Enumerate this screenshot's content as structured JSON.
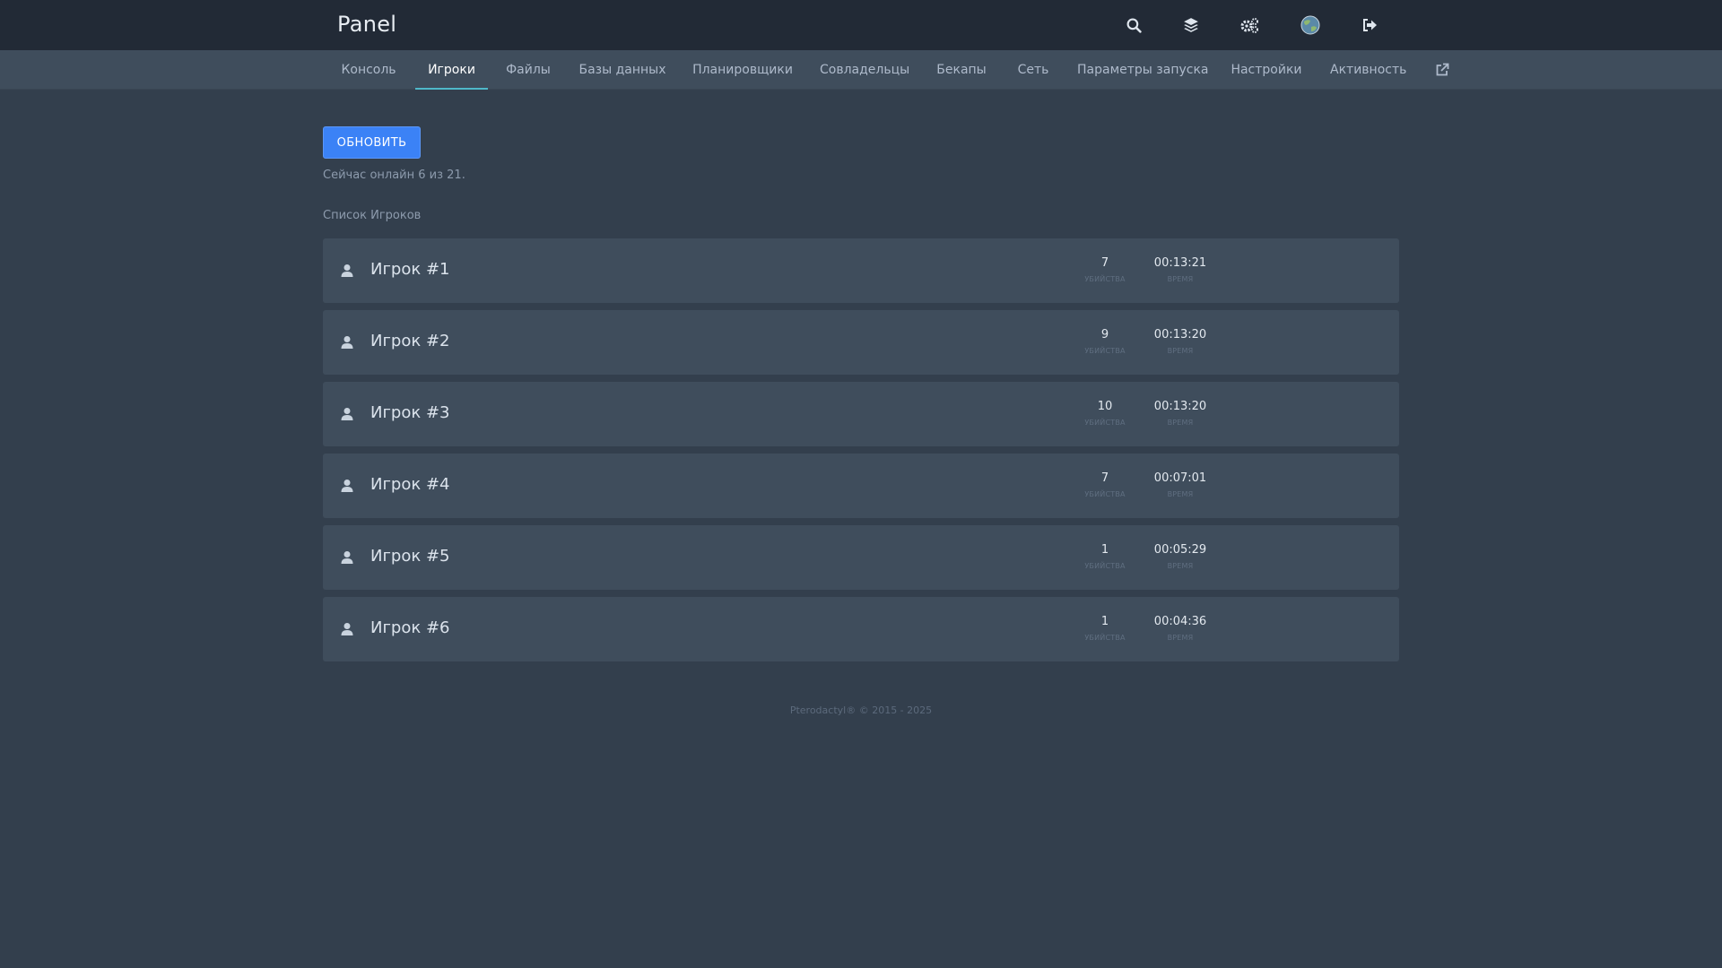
{
  "brand": "Panel",
  "topbar_icons": [
    "search-icon",
    "layers-icon",
    "gears-icon",
    "globe-icon",
    "logout-icon"
  ],
  "tabs": [
    {
      "label": "Консоль"
    },
    {
      "label": "Игроки",
      "active": true
    },
    {
      "label": "Файлы"
    },
    {
      "label": "Базы данных"
    },
    {
      "label": "Планировщики"
    },
    {
      "label": "Совладельцы"
    },
    {
      "label": "Бекапы"
    },
    {
      "label": "Сеть"
    },
    {
      "label": "Параметры запуска"
    },
    {
      "label": "Настройки"
    },
    {
      "label": "Активность"
    }
  ],
  "refresh_label": "ОБНОВИТЬ",
  "online_text": "Сейчас онлайн 6 из 21.",
  "list_title": "Список Игроков",
  "stat_labels": {
    "kills": "УБИЙСТВА",
    "time": "ВРЕМЯ"
  },
  "players": [
    {
      "name": "Игрок #1",
      "kills": "7",
      "time": "00:13:21"
    },
    {
      "name": "Игрок #2",
      "kills": "9",
      "time": "00:13:20"
    },
    {
      "name": "Игрок #3",
      "kills": "10",
      "time": "00:13:20"
    },
    {
      "name": "Игрок #4",
      "kills": "7",
      "time": "00:07:01"
    },
    {
      "name": "Игрок #5",
      "kills": "1",
      "time": "00:05:29"
    },
    {
      "name": "Игрок #6",
      "kills": "1",
      "time": "00:04:36"
    }
  ],
  "footer": "Pterodactyl® © 2015 - 2025",
  "colors": {
    "background": "#333f4d",
    "topbar": "#222a36",
    "accent": "#3b82f6",
    "tab_active_underline": "#4fb8c9"
  }
}
